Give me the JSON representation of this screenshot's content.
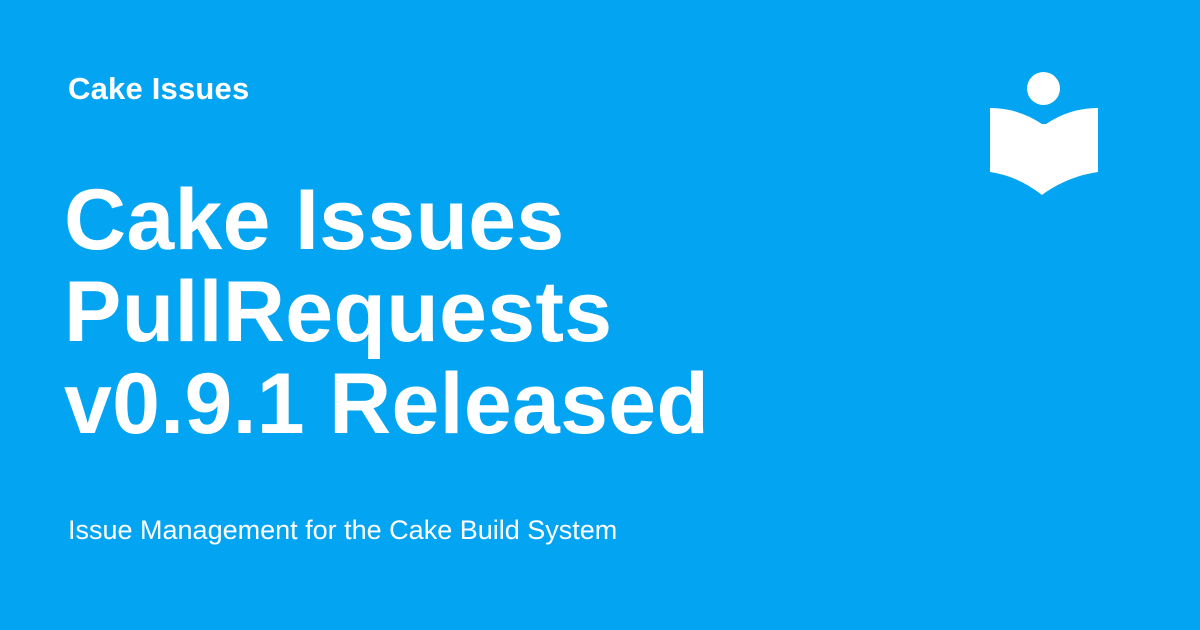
{
  "site": {
    "name": "Cake Issues"
  },
  "post": {
    "title_lines": [
      "Cake Issues",
      "PullRequests",
      "v0.9.1 Released"
    ],
    "description": "Issue Management for the Cake Build System"
  },
  "logo": {
    "icon": "reader-book-icon"
  },
  "colors": {
    "background": "#03a4f1",
    "foreground": "#ffffff"
  }
}
